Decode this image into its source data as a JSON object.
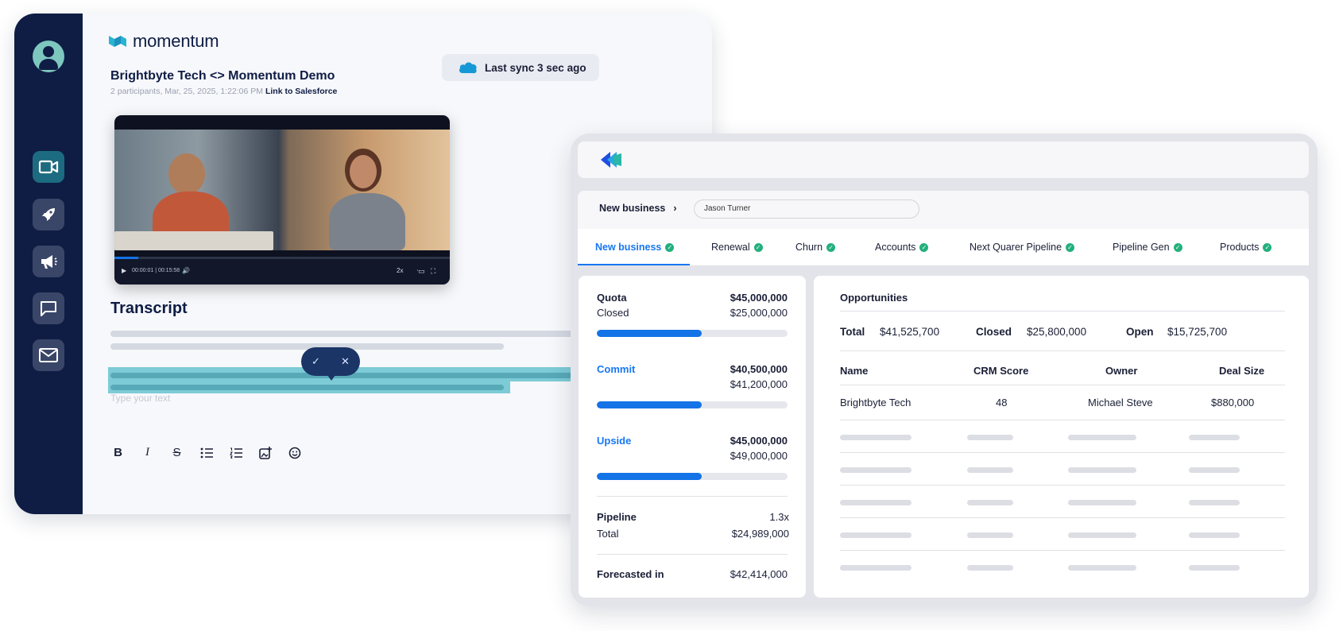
{
  "call": {
    "brand": "momentum",
    "meeting_title": "Brightbyte Tech <> Momentum Demo",
    "meeting_meta": "2 participants, Mar, 25, 2025, 1:22:06 PM",
    "meeting_link": "Link to Salesforce",
    "sync_status": "Last sync 3 sec ago",
    "video": {
      "time": "00:00:01 | 00:15:58",
      "speed": "2x",
      "progress": 0.07
    },
    "transcript_title": "Transcript",
    "placeholder": "Type your text",
    "rail_icons": [
      "user-avatar",
      "video-icon",
      "rocket-icon",
      "megaphone-icon",
      "chat-icon",
      "mail-icon"
    ],
    "toolbar": [
      "bold",
      "italic",
      "strikethrough",
      "bullet-list",
      "numbered-list",
      "insert-image",
      "emoji"
    ]
  },
  "crm": {
    "breadcrumb": "New business",
    "search_value": "Jason Turner",
    "tabs": [
      "New business",
      "Renewal",
      "Churn",
      "Accounts",
      "Next Quarer Pipeline",
      "Pipeline Gen",
      "Products"
    ],
    "active_tab": 0,
    "forecast": {
      "quota_label": "Quota",
      "quota_value": "$45,000,000",
      "closed_label": "Closed",
      "closed_value": "$25,000,000",
      "commit_label": "Commit",
      "commit_value": "$40,500,000",
      "commit_sub": "$41,200,000",
      "upside_label": "Upside",
      "upside_value": "$45,000,000",
      "upside_sub": "$49,000,000",
      "bar_fill": 0.55,
      "pipeline_label": "Pipeline",
      "pipeline_value": "1.3x",
      "total_label": "Total",
      "total_value": "$24,989,000",
      "forecasted_label": "Forecasted in",
      "forecasted_value": "$42,414,000"
    },
    "opportunities": {
      "title": "Opportunities",
      "total_label": "Total",
      "total_value": "$41,525,700",
      "closed_label": "Closed",
      "closed_value": "$25,800,000",
      "open_label": "Open",
      "open_value": "$15,725,700",
      "columns": [
        "Name",
        "CRM Score",
        "Owner",
        "Deal Size"
      ],
      "rows": [
        {
          "name": "Brightbyte Tech",
          "score": "48",
          "owner": "Michael Steve",
          "deal": "$880,000"
        }
      ]
    },
    "accent": "#1877f2",
    "check_color": "#22b07d"
  }
}
